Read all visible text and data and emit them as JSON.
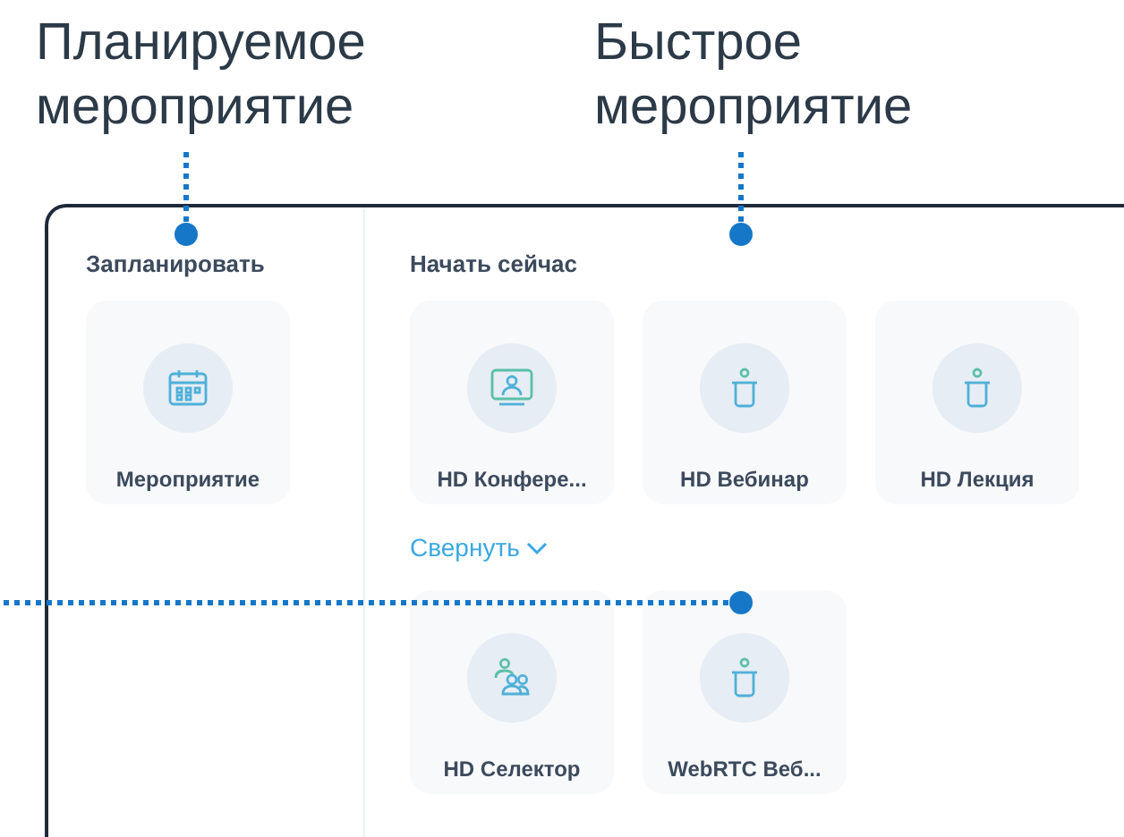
{
  "callouts": [
    {
      "label": "Планируемое мероприятие"
    },
    {
      "label": "Быстрое мероприятие"
    }
  ],
  "schedule": {
    "heading": "Запланировать",
    "cards": [
      {
        "kind": "calendar",
        "label": "Мероприятие"
      }
    ]
  },
  "start_now": {
    "heading": "Начать сейчас",
    "cards": [
      {
        "kind": "screen",
        "label": "HD Конфере..."
      },
      {
        "kind": "podium",
        "label": "HD Вебинар"
      },
      {
        "kind": "podium",
        "label": "HD Лекция"
      }
    ],
    "collapse": {
      "label": "Свернуть",
      "expanded": true
    },
    "more_cards": [
      {
        "kind": "group",
        "label": "HD Селектор"
      },
      {
        "kind": "podium",
        "label": "WebRTC Веб..."
      }
    ]
  }
}
